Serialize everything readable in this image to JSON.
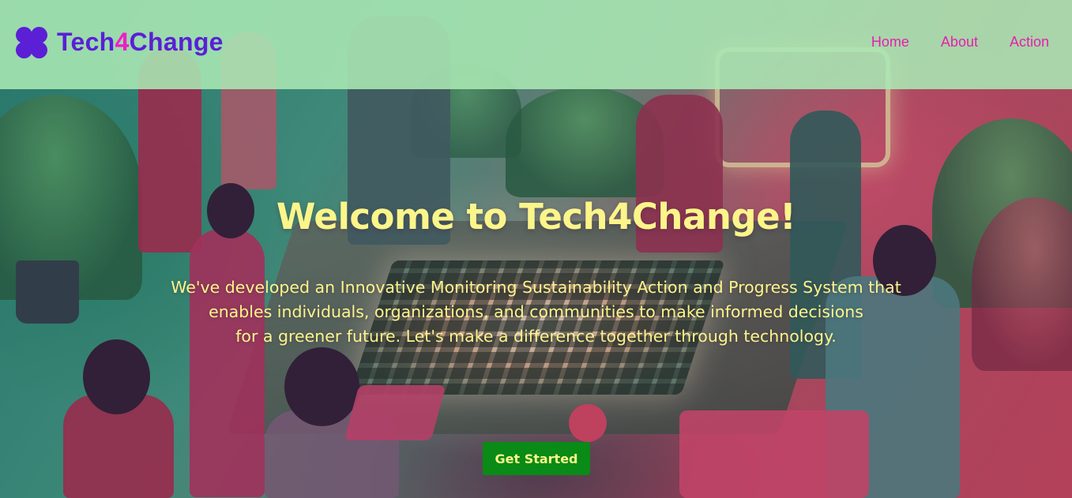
{
  "navbar": {
    "brand_prefix": "Tech",
    "brand_number": "4",
    "brand_suffix": "Change",
    "logo_icon": "clover-logo-icon",
    "links": [
      {
        "label": "Home"
      },
      {
        "label": "About"
      },
      {
        "label": "Action"
      }
    ]
  },
  "hero": {
    "title": "Welcome to Tech4Change!",
    "description_lines": [
      "We've developed an Innovative Monitoring Sustainability Action and Progress System that",
      "enables individuals, organizations, and communities to make informed decisions",
      "for a greener future. Let's make a difference together through technology."
    ],
    "cta_label": "Get Started"
  },
  "colors": {
    "brand_purple": "#5b1fd6",
    "brand_pink": "#ee1fc8",
    "nav_link": "#e61fb0",
    "navbar_bg": "#aae8b4",
    "hero_text": "#fbf58a",
    "cta_bg": "#0a8a16"
  }
}
